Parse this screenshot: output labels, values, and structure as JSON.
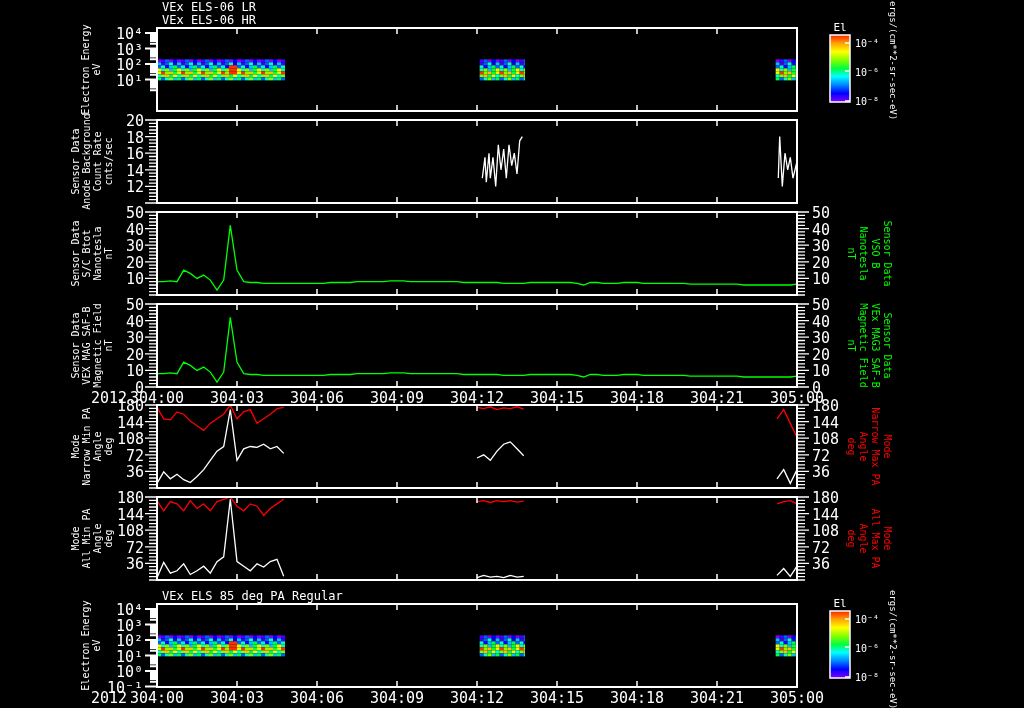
{
  "panels": [
    {
      "kind": "spectrogram",
      "titles": [
        "VEx ELS-06 LR",
        "VEx ELS-06 HR"
      ],
      "left_label": [
        "Electron Energy",
        "eV"
      ],
      "yticks": [
        "10⁴",
        "10³",
        "10²",
        "10¹"
      ],
      "colorbar": {
        "title": "El",
        "ticks": [
          "10⁻⁴",
          "10⁻⁶",
          "10⁻⁸"
        ],
        "unit": "ergs/(cm**2-sr-sec-eV)"
      }
    },
    {
      "kind": "trace",
      "left_label": [
        "Sensor Data",
        "Anode Background",
        "Count Rate",
        "cnts/sec"
      ],
      "yticks": [
        "20",
        "18",
        "16",
        "14",
        "12"
      ]
    },
    {
      "kind": "line",
      "left_label": [
        "Sensor Data",
        "S/C Btot",
        "Nanotesla",
        "nT"
      ],
      "right_label": [
        "Sensor Data",
        "VSO B",
        "Nanotesla",
        "nT"
      ],
      "right_ticks": [
        "50",
        "40",
        "30",
        "20",
        "10"
      ],
      "chart_data": {
        "type": "line",
        "categories": [
          null,
          null,
          null,
          null,
          null,
          null,
          null,
          null,
          null,
          null,
          null,
          null,
          null,
          null,
          null,
          null,
          null,
          null,
          null,
          null,
          null,
          null,
          null,
          null,
          null,
          null,
          null,
          null,
          null,
          null,
          null,
          null,
          null,
          null,
          null,
          null,
          null,
          null,
          null,
          null,
          null,
          null,
          null,
          null,
          null,
          null,
          null,
          null,
          null,
          null,
          null,
          null,
          null,
          null,
          null,
          null,
          null,
          null,
          null,
          null,
          null,
          null,
          null,
          null,
          null,
          null,
          null,
          null,
          null,
          null,
          null,
          null,
          null,
          null,
          null,
          null,
          null,
          null,
          null,
          null,
          null,
          null,
          null,
          null,
          null,
          null,
          null,
          null,
          null,
          null,
          null,
          null,
          null,
          null,
          null,
          null,
          null
        ],
        "series": [
          {
            "color": "#00ff00",
            "values": [
              8,
              8,
              8.5,
              8,
              15,
              13,
              10,
              12,
              9,
              3,
              9,
              42,
              15,
              8,
              7.5,
              7.5,
              7,
              7,
              7,
              7,
              7,
              7,
              7,
              7,
              7,
              7,
              7.5,
              7.5,
              7.5,
              7.5,
              8,
              8,
              8,
              8,
              8,
              8.5,
              8.5,
              8.5,
              8,
              8,
              8,
              8,
              8,
              8,
              8,
              8,
              7.5,
              7.5,
              7.5,
              7.5,
              7.5,
              7.5,
              7,
              7,
              7,
              7,
              7.5,
              7.5,
              7.5,
              7.5,
              7.5,
              7.5,
              7.5,
              7,
              6,
              7.5,
              7.5,
              7,
              7,
              7,
              7.5,
              7.5,
              7.5,
              7,
              7,
              7,
              7,
              7,
              7,
              7,
              6.5,
              6.5,
              6.5,
              6.5,
              6.5,
              6.5,
              6.5,
              6.5,
              6,
              6,
              6,
              6,
              6,
              6,
              6,
              6,
              6.5
            ]
          }
        ],
        "ylim": [
          0,
          50
        ],
        "yticks": [
          {
            "value": 10,
            "label": "10"
          },
          {
            "value": 20,
            "label": "20"
          },
          {
            "value": 30,
            "label": "30"
          },
          {
            "value": 40,
            "label": "40"
          },
          {
            "value": 50,
            "label": "50"
          }
        ]
      }
    },
    {
      "kind": "line",
      "left_label": [
        "Sensor Data",
        "VEX MAG SAF-B",
        "Magnetic Field",
        "nT"
      ],
      "right_label": [
        "Sensor Data",
        "VEx MAG3 SAF-B",
        "Magnetic Field",
        "nT"
      ],
      "right_ticks": [
        "50",
        "40",
        "30",
        "20",
        "10",
        "0"
      ],
      "year_label": "2012",
      "chart_data": {
        "type": "line",
        "categories": [
          "304:00",
          null,
          null,
          null,
          null,
          null,
          null,
          null,
          null,
          null,
          null,
          null,
          "304:03",
          null,
          null,
          null,
          null,
          null,
          null,
          null,
          null,
          null,
          null,
          null,
          "304:06",
          null,
          null,
          null,
          null,
          null,
          null,
          null,
          null,
          null,
          null,
          null,
          "304:09",
          null,
          null,
          null,
          null,
          null,
          null,
          null,
          null,
          null,
          null,
          null,
          "304:12",
          null,
          null,
          null,
          null,
          null,
          null,
          null,
          null,
          null,
          null,
          null,
          "304:15",
          null,
          null,
          null,
          null,
          null,
          null,
          null,
          null,
          null,
          null,
          null,
          "304:18",
          null,
          null,
          null,
          null,
          null,
          null,
          null,
          null,
          null,
          null,
          null,
          "304:21",
          null,
          null,
          null,
          null,
          null,
          null,
          null,
          null,
          null,
          null,
          null,
          "305:00"
        ],
        "series": [
          {
            "color": "#00ff00",
            "values": [
              8,
              8,
              8.5,
              8,
              15,
              13,
              10,
              12,
              9,
              3,
              9,
              42,
              15,
              8,
              7.5,
              7.5,
              7,
              7,
              7,
              7,
              7,
              7,
              7,
              7,
              7,
              7,
              7.5,
              7.5,
              7.5,
              7.5,
              8,
              8,
              8,
              8,
              8,
              8.5,
              8.5,
              8.5,
              8,
              8,
              8,
              8,
              8,
              8,
              8,
              8,
              7.5,
              7.5,
              7.5,
              7.5,
              7.5,
              7.5,
              7,
              7,
              7,
              7,
              7.5,
              7.5,
              7.5,
              7.5,
              7.5,
              7.5,
              7.5,
              7,
              6,
              7.5,
              7.5,
              7,
              7,
              7,
              7.5,
              7.5,
              7.5,
              7,
              7,
              7,
              7,
              7,
              7,
              7,
              6.5,
              6.5,
              6.5,
              6.5,
              6.5,
              6.5,
              6.5,
              6.5,
              6,
              6,
              6,
              6,
              6,
              6,
              6,
              6,
              6.5
            ]
          }
        ],
        "ylim": [
          0,
          50
        ],
        "yticks": [
          {
            "value": 0,
            "label": "0"
          },
          {
            "value": 10,
            "label": "10"
          },
          {
            "value": 20,
            "label": "20"
          },
          {
            "value": 30,
            "label": "30"
          },
          {
            "value": 40,
            "label": "40"
          },
          {
            "value": 50,
            "label": "50"
          }
        ]
      }
    },
    {
      "kind": "line",
      "left_label": [
        "Mode",
        "Narrow Min PA",
        "Angle",
        "deg"
      ],
      "right_label": [
        "Mode",
        "Narrow Max PA",
        "Angle",
        "deg"
      ],
      "right_ticks": [
        "180",
        "144",
        "108",
        "72",
        "36"
      ],
      "chart_data": {
        "type": "line",
        "categories": [
          null,
          null,
          null,
          null,
          null,
          null,
          null,
          null,
          null,
          null,
          null,
          null,
          null,
          null,
          null,
          null,
          null,
          null,
          null,
          null,
          null,
          null,
          null,
          null,
          null,
          null,
          null,
          null,
          null,
          null,
          null,
          null,
          null,
          null,
          null,
          null,
          null,
          null,
          null,
          null,
          null,
          null,
          null,
          null,
          null,
          null,
          null,
          null,
          null,
          null,
          null,
          null,
          null,
          null,
          null,
          null,
          null,
          null,
          null,
          null,
          null,
          null,
          null,
          null,
          null,
          null,
          null,
          null,
          null,
          null,
          null,
          null,
          null,
          null,
          null,
          null,
          null,
          null,
          null,
          null,
          null,
          null,
          null,
          null,
          null,
          null,
          null,
          null,
          null,
          null,
          null,
          null,
          null,
          null,
          null,
          null,
          null
        ],
        "series": [
          {
            "color": "#ff0000",
            "values": [
              175,
              150,
              148,
              165,
              160,
              145,
              135,
              125,
              140,
              150,
              160,
              180,
              150,
              165,
              170,
              140,
              150,
              160,
              172,
              175,
              null,
              null,
              null,
              null,
              null,
              null,
              null,
              null,
              null,
              null,
              null,
              null,
              null,
              null,
              null,
              null,
              null,
              null,
              null,
              null,
              null,
              null,
              null,
              null,
              null,
              null,
              null,
              null,
              175,
              172,
              176,
              170,
              174,
              172,
              176,
              171,
              null,
              null,
              null,
              null,
              null,
              null,
              null,
              null,
              null,
              null,
              null,
              null,
              null,
              null,
              null,
              null,
              null,
              null,
              null,
              null,
              null,
              null,
              null,
              null,
              null,
              null,
              null,
              null,
              null,
              null,
              null,
              null,
              null,
              null,
              null,
              null,
              null,
              150,
              170,
              140,
              110
            ]
          },
          {
            "color": "#ffffff",
            "values": [
              10,
              35,
              20,
              30,
              18,
              12,
              25,
              40,
              60,
              80,
              90,
              170,
              60,
              85,
              90,
              88,
              95,
              85,
              90,
              75,
              null,
              null,
              null,
              null,
              null,
              null,
              null,
              null,
              null,
              null,
              null,
              null,
              null,
              null,
              null,
              null,
              null,
              null,
              null,
              null,
              null,
              null,
              null,
              null,
              null,
              null,
              null,
              null,
              65,
              72,
              60,
              80,
              95,
              100,
              85,
              70,
              null,
              null,
              null,
              null,
              null,
              null,
              null,
              null,
              null,
              null,
              null,
              null,
              null,
              null,
              null,
              null,
              null,
              null,
              null,
              null,
              null,
              null,
              null,
              null,
              null,
              null,
              null,
              null,
              null,
              null,
              null,
              null,
              null,
              null,
              null,
              null,
              null,
              20,
              40,
              10,
              40
            ]
          }
        ],
        "ylim": [
          0,
          180
        ],
        "yticks": [
          {
            "value": 36,
            "label": "36"
          },
          {
            "value": 72,
            "label": "72"
          },
          {
            "value": 108,
            "label": "108"
          },
          {
            "value": 144,
            "label": "144"
          },
          {
            "value": 180,
            "label": "180"
          }
        ]
      }
    },
    {
      "kind": "line",
      "left_label": [
        "Mode",
        "All Min PA",
        "Angle",
        "deg"
      ],
      "right_label": [
        "Mode",
        "All Max PA",
        "Angle",
        "deg"
      ],
      "right_ticks": [
        "180",
        "144",
        "108",
        "72",
        "36"
      ],
      "chart_data": {
        "type": "line",
        "categories": [
          null,
          null,
          null,
          null,
          null,
          null,
          null,
          null,
          null,
          null,
          null,
          null,
          null,
          null,
          null,
          null,
          null,
          null,
          null,
          null,
          null,
          null,
          null,
          null,
          null,
          null,
          null,
          null,
          null,
          null,
          null,
          null,
          null,
          null,
          null,
          null,
          null,
          null,
          null,
          null,
          null,
          null,
          null,
          null,
          null,
          null,
          null,
          null,
          null,
          null,
          null,
          null,
          null,
          null,
          null,
          null,
          null,
          null,
          null,
          null,
          null,
          null,
          null,
          null,
          null,
          null,
          null,
          null,
          null,
          null,
          null,
          null,
          null,
          null,
          null,
          null,
          null,
          null,
          null,
          null,
          null,
          null,
          null,
          null,
          null,
          null,
          null,
          null,
          null,
          null,
          null,
          null,
          null,
          null,
          null,
          null,
          null
        ],
        "series": [
          {
            "color": "#ff0000",
            "values": [
              172,
              150,
              170,
              165,
              150,
              172,
              155,
              165,
              150,
              170,
              175,
              180,
              160,
              150,
              165,
              160,
              140,
              155,
              165,
              175,
              null,
              null,
              null,
              null,
              null,
              null,
              null,
              null,
              null,
              null,
              null,
              null,
              null,
              null,
              null,
              null,
              null,
              null,
              null,
              null,
              null,
              null,
              null,
              null,
              null,
              null,
              null,
              null,
              170,
              172,
              168,
              172,
              170,
              172,
              169,
              171,
              null,
              null,
              null,
              null,
              null,
              null,
              null,
              null,
              null,
              null,
              null,
              null,
              null,
              null,
              null,
              null,
              null,
              null,
              null,
              null,
              null,
              null,
              null,
              null,
              null,
              null,
              null,
              null,
              null,
              null,
              null,
              null,
              null,
              null,
              null,
              null,
              null,
              165,
              170,
              172,
              165
            ]
          },
          {
            "color": "#ffffff",
            "values": [
              5,
              38,
              15,
              20,
              35,
              12,
              20,
              30,
              15,
              40,
              50,
              175,
              40,
              30,
              20,
              35,
              28,
              40,
              45,
              8,
              null,
              null,
              null,
              null,
              null,
              null,
              null,
              null,
              null,
              null,
              null,
              null,
              null,
              null,
              null,
              null,
              null,
              null,
              null,
              null,
              null,
              null,
              null,
              null,
              null,
              null,
              null,
              null,
              5,
              10,
              6,
              8,
              5,
              10,
              6,
              8,
              null,
              null,
              null,
              null,
              null,
              null,
              null,
              null,
              null,
              null,
              null,
              null,
              null,
              null,
              null,
              null,
              null,
              null,
              null,
              null,
              null,
              null,
              null,
              null,
              null,
              null,
              null,
              null,
              null,
              null,
              null,
              null,
              null,
              null,
              null,
              null,
              null,
              10,
              25,
              8,
              30
            ]
          }
        ],
        "ylim": [
          0,
          180
        ],
        "yticks": [
          {
            "value": 36,
            "label": "36"
          },
          {
            "value": 72,
            "label": "72"
          },
          {
            "value": 108,
            "label": "108"
          },
          {
            "value": 144,
            "label": "144"
          },
          {
            "value": 180,
            "label": "180"
          }
        ]
      }
    },
    {
      "kind": "spectrogram",
      "titles": [
        "VEx ELS 85 deg PA Regular"
      ],
      "left_label": [
        "Electron Energy",
        "eV"
      ],
      "yticks": [
        "10⁴",
        "10³",
        "10²",
        "10¹",
        "10⁰",
        "10⁻¹"
      ],
      "year_label": "2012",
      "xtick_labels": [
        "304:00",
        "304:03",
        "304:06",
        "304:09",
        "304:12",
        "304:15",
        "304:18",
        "304:21",
        "305:00"
      ],
      "colorbar": {
        "title": "El",
        "ticks": [
          "10⁻⁴",
          "10⁻⁶",
          "10⁻⁸"
        ],
        "unit": "ergs/(cm**2-sr-sec-eV)"
      }
    }
  ]
}
